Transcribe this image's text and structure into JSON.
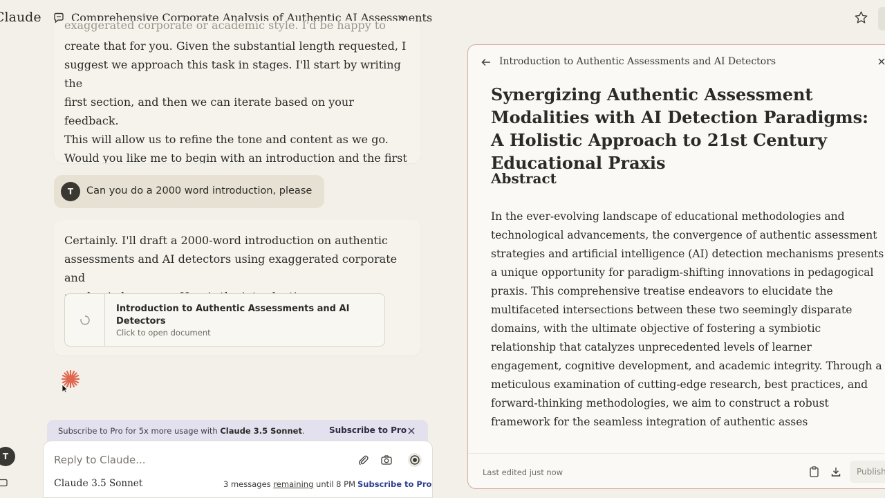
{
  "topbar": {
    "brand": "Claude",
    "chat_title": "Comprehensive Corporate Analysis of Authentic AI Assessments"
  },
  "chat": {
    "assistant_msg_1": {
      "faded_line": "exaggerated corporate or academic style. I'd be happy to",
      "text": "create that for you. Given the substantial length requested, I\nsuggest we approach this task in stages. I'll start by writing the\nfirst section, and then we can iterate based on your feedback.\nThis will allow us to refine the tone and content as we go.\nWould you like me to begin with an introduction and the first\nmain section?"
    },
    "user_msg": {
      "avatar": "T",
      "text": "Can you do a 2000 word introduction, please"
    },
    "assistant_msg_2": {
      "text": "Certainly. I'll draft a 2000-word introduction on authentic\nassessments and AI detectors using exaggerated corporate and\nacademic language. Here's the introduction:",
      "artifact": {
        "title": "Introduction to Authentic Assessments and AI Detectors",
        "subtitle": "Click to open document"
      }
    }
  },
  "subscribe_banner": {
    "text_prefix": "Subscribe to Pro for 5x more usage with ",
    "model": "Claude 3.5 Sonnet",
    "text_suffix": ".",
    "button": "Subscribe to Pro"
  },
  "input": {
    "placeholder": "Reply to Claude...",
    "model_name": "Claude",
    "model_version": "3.5 Sonnet",
    "usage_prefix": "3 messages ",
    "usage_underlined": "remaining",
    "usage_suffix": " until 8 PM",
    "usage_link": "Subscribe to Pro"
  },
  "sidebar": {
    "avatar": "T"
  },
  "artifact_panel": {
    "header_title": "Introduction to Authentic Assessments and AI Detectors",
    "doc_title": "Synergizing Authentic Assessment Modalities with AI Detection Paradigms: A Holistic Approach to 21st Century Educational Praxis",
    "section_heading": "Abstract",
    "body": "In the ever-evolving landscape of educational methodologies and technological advancements, the convergence of authentic assessment strategies and artificial intelligence (AI) detection mechanisms presents a unique opportunity for paradigm-shifting innovations in pedagogical praxis. This comprehensive treatise endeavors to elucidate the multifaceted intersections between these two seemingly disparate domains, with the ultimate objective of fostering a symbiotic relationship that catalyzes unprecedented levels of learner engagement, cognitive development, and academic integrity. Through a meticulous examination of cutting-edge research, best practices, and forward-thinking methodologies, we aim to construct a robust framework for the seamless integration of authentic asses",
    "footer": {
      "last_edited": "Last edited just now",
      "publish": "Publish"
    }
  },
  "colors": {
    "background": "#f2f0e8",
    "accent_orange": "#e0664f",
    "link_blue": "#2f3f8f",
    "banner_bg": "#e3e1ee"
  },
  "icons": [
    "chat-icon",
    "chevron-down-icon",
    "star-icon",
    "spinner-icon",
    "claude-spark-icon",
    "close-icon",
    "paperclip-icon",
    "camera-icon",
    "record-icon",
    "back-arrow-icon",
    "copy-icon",
    "download-icon",
    "side-panel-icon"
  ]
}
